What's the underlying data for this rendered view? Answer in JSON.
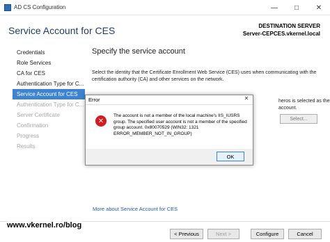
{
  "window": {
    "title": "AD CS Configuration",
    "minimize": "—",
    "maximize": "□",
    "close": "✕"
  },
  "header": {
    "title": "Service Account for CES",
    "destination_label": "DESTINATION SERVER",
    "destination_server": "Server-CEPCES.vkernel.local"
  },
  "nav": {
    "items": [
      {
        "label": "Credentials",
        "state": "normal"
      },
      {
        "label": "Role Services",
        "state": "normal"
      },
      {
        "label": "CA for CES",
        "state": "normal"
      },
      {
        "label": "Authentication Type for C...",
        "state": "normal"
      },
      {
        "label": "Service Account for CES",
        "state": "active"
      },
      {
        "label": "Authentication Type for C...",
        "state": "disabled"
      },
      {
        "label": "Server Certificate",
        "state": "disabled"
      },
      {
        "label": "Confirmation",
        "state": "disabled"
      },
      {
        "label": "Progress",
        "state": "disabled"
      },
      {
        "label": "Results",
        "state": "disabled"
      }
    ]
  },
  "main": {
    "title": "Specify the service account",
    "description": "Select the identity that the Certificate Enrollment Web Service (CES) uses when communicating with the certification authority (CA) and other services on the network.",
    "partial_line1": "heros is selected as the",
    "partial_line2": "account.",
    "select_button": "Select...",
    "more_link": "More about Service Account for CES"
  },
  "footer": {
    "previous": "< Previous",
    "next": "Next >",
    "configure": "Configure",
    "cancel": "Cancel",
    "watermark": "www.vkernel.ro/blog"
  },
  "dialog": {
    "title": "Error",
    "close": "✕",
    "message": "The account is not a member of the local machine's IIS_IUSRS group. The specified user account is not a member of the specified group account. 0x80070529 (WIN32: 1321 ERROR_MEMBER_NOT_IN_GROUP)",
    "ok": "OK",
    "icon": "error-icon"
  },
  "colors": {
    "accent": "#3c83d4",
    "title": "#1f3f6b",
    "error": "#d71920",
    "link": "#1a5fb4"
  }
}
